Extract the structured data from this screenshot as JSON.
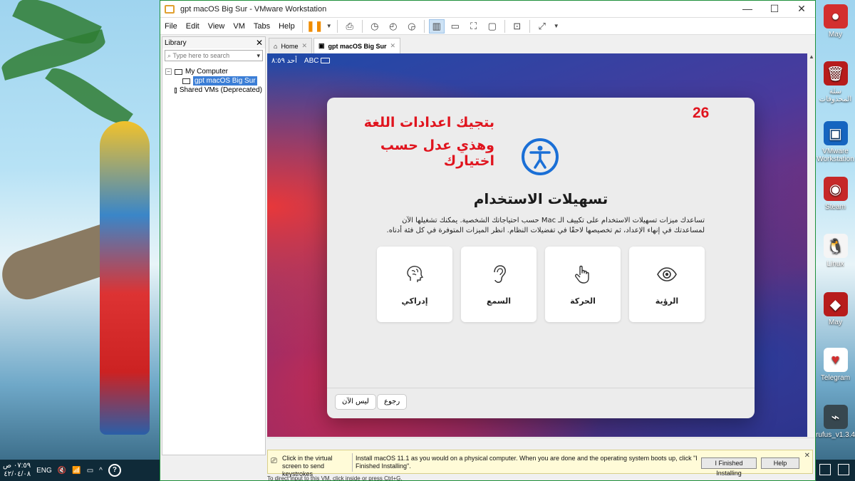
{
  "window": {
    "title": "gpt macOS Big Sur - VMware Workstation",
    "controls": {
      "minimize": "—",
      "maximize": "☐",
      "close": "✕"
    }
  },
  "menubar": {
    "items": [
      "File",
      "Edit",
      "View",
      "VM",
      "Tabs",
      "Help"
    ]
  },
  "library": {
    "title": "Library",
    "close": "✕",
    "search_placeholder": "Type here to search",
    "tree": {
      "root": "My Computer",
      "vm": "gpt macOS Big Sur",
      "shared": "Shared VMs (Deprecated)"
    }
  },
  "tabs": [
    {
      "label": "Home",
      "close": "✕"
    },
    {
      "label": "gpt macOS Big Sur",
      "close": "✕"
    }
  ],
  "vm_status": {
    "time": "أحد ٨:٥٩",
    "input": "ABC"
  },
  "dialog": {
    "annotation_line1": "بتجيك اعدادات اللغة",
    "annotation_line2": "وهذي عدل حسب اختيارك",
    "step_number": "26",
    "title": "تسهيلات الاستخدام",
    "description": "تساعدك ميزات تسهيلات الاستخدام على تكييف الـ Mac حسب احتياجاتك الشخصية. يمكنك تشغيلها الآن لمساعدتك في إنهاء الإعداد، ثم تخصيصها لاحقًا في تفضيلات النظام. انظر الميزات المتوفرة في كل فئة أدناه.",
    "cards": [
      {
        "label": "إدراكي",
        "icon": "brain-icon"
      },
      {
        "label": "السمع",
        "icon": "ear-icon"
      },
      {
        "label": "الحركة",
        "icon": "hand-pointer-icon"
      },
      {
        "label": "الرؤية",
        "icon": "eye-icon"
      }
    ],
    "not_now_button": "ليس الآن",
    "back_button": "رجوع"
  },
  "hint": {
    "left_text": "Click in the virtual screen to send keystrokes",
    "message": "Install macOS 11.1 as you would on a physical computer. When you are done and the operating system boots up, click \"I Finished Installing\".",
    "finished_button": "I Finished Installing",
    "help_button": "Help",
    "close": "✕"
  },
  "statusbar": {
    "text": "To direct input to this VM, click inside or press Ctrl+G."
  },
  "desktop_icons": [
    {
      "label": "May",
      "icon": "angry-birds-icon",
      "color": "#d32f2f"
    },
    {
      "label": "سلة المحذوفات",
      "icon": "recycle-bin-icon",
      "color": "#b71c1c"
    },
    {
      "label": "VMware Workstation",
      "icon": "vmware-icon",
      "color": "#1565c0"
    },
    {
      "label": "Steam",
      "icon": "steam-icon",
      "color": "#c62828"
    },
    {
      "label": "Linux",
      "icon": "linux-penguin-icon",
      "color": "#212121"
    },
    {
      "label": "May",
      "icon": "game-icon",
      "color": "#b71c1c"
    },
    {
      "label": "Telegram",
      "icon": "cards-icon",
      "color": "#ffffff"
    },
    {
      "label": "rufus_v1.3.4",
      "icon": "usb-icon",
      "color": "#37474f"
    }
  ],
  "taskbar": {
    "lang": "ENG",
    "time": "٠٧:٥٩ ص",
    "date": "٤٢/٠٤/٠٨",
    "help_icon": "?"
  },
  "colors": {
    "accent_red": "#e0141e",
    "access_blue": "#1a6fd6",
    "selection_blue": "#3b7ed6",
    "window_border": "#1e8f3a"
  }
}
